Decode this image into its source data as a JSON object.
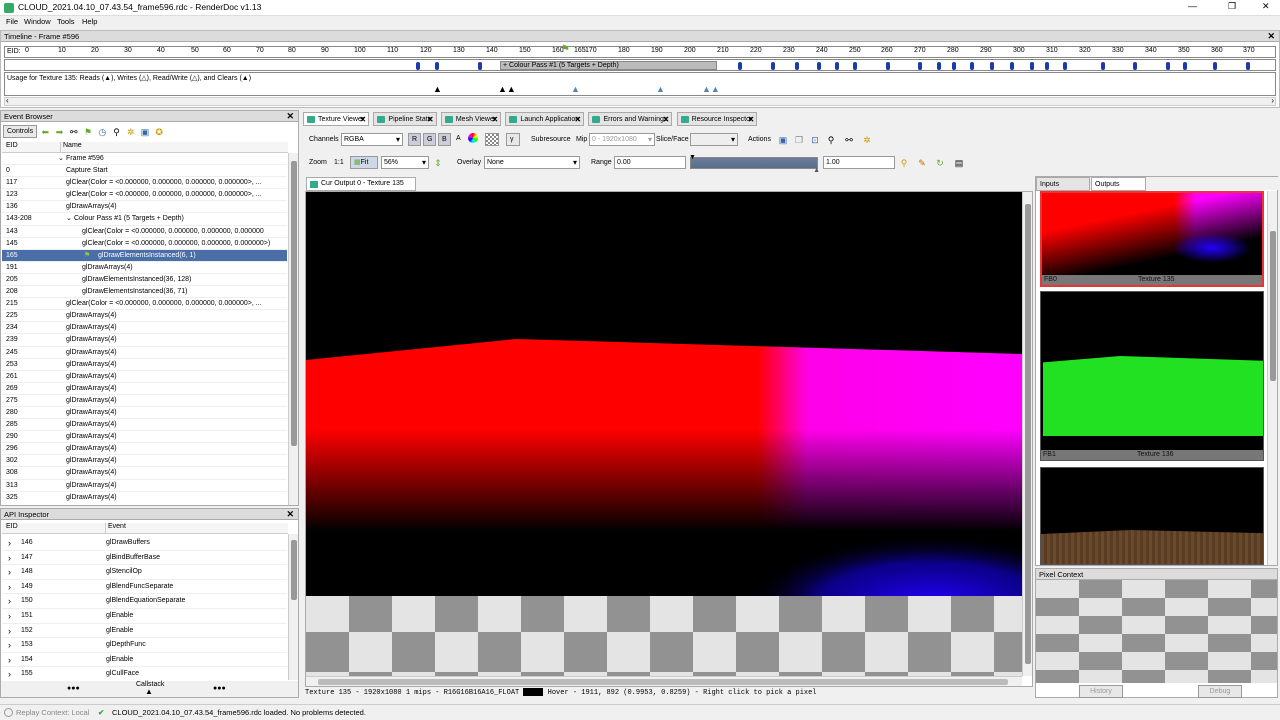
{
  "window": {
    "title": "CLOUD_2021.04.10_07.43.54_frame596.rdc - RenderDoc v1.13",
    "min": "—",
    "max": "❐",
    "close": "✕"
  },
  "menu": [
    "File",
    "Window",
    "Tools",
    "Help"
  ],
  "timeline": {
    "title": "Timeline - Frame #596",
    "eid_label": "EID:",
    "ticks": [
      "0",
      "10",
      "20",
      "30",
      "40",
      "50",
      "60",
      "70",
      "80",
      "90",
      "100",
      "110",
      "120",
      "130",
      "140",
      "150",
      "160",
      "165",
      "170",
      "180",
      "190",
      "200",
      "210",
      "220",
      "230",
      "240",
      "250",
      "260",
      "270",
      "280",
      "290",
      "300",
      "310",
      "320",
      "330",
      "340",
      "350",
      "360",
      "370"
    ],
    "pass_label": "+ Colour Pass #1 (5 Targets + Depth)",
    "usage": "Usage for Texture 135: Reads (▲), Writes (△), Read/Write (△), and Clears (▲)"
  },
  "event_browser": {
    "title": "Event Browser",
    "controls": "Controls",
    "col_eid": "EID",
    "col_name": "Name",
    "rows": [
      {
        "eid": "",
        "name": "Frame #596",
        "indent": 0,
        "tree": "v"
      },
      {
        "eid": "0",
        "name": "Capture Start",
        "indent": 1
      },
      {
        "eid": "117",
        "name": "glClear(Color = <0.000000, 0.000000, 0.000000, 0.000000>, ...",
        "indent": 1
      },
      {
        "eid": "123",
        "name": "glClear(Color = <0.000000, 0.000000, 0.000000, 0.000000>, ...",
        "indent": 1
      },
      {
        "eid": "136",
        "name": "glDrawArrays(4)",
        "indent": 1
      },
      {
        "eid": "143-208",
        "name": "Colour Pass #1 (5 Targets + Depth)",
        "indent": 1,
        "tree": "v"
      },
      {
        "eid": "143",
        "name": "glClear(Color = <0.000000, 0.000000, 0.000000, 0.000000",
        "indent": 2
      },
      {
        "eid": "145",
        "name": "glClear(Color = <0.000000, 0.000000, 0.000000, 0.000000>)",
        "indent": 2
      },
      {
        "eid": "165",
        "name": "glDrawElementsInstanced(6, 1)",
        "indent": 2,
        "selected": true
      },
      {
        "eid": "191",
        "name": "glDrawArrays(4)",
        "indent": 2
      },
      {
        "eid": "205",
        "name": "glDrawElementsInstanced(36, 128)",
        "indent": 2
      },
      {
        "eid": "208",
        "name": "glDrawElementsInstanced(36, 71)",
        "indent": 2
      },
      {
        "eid": "215",
        "name": "glClear(Color = <0.000000, 0.000000, 0.000000, 0.000000>, ...",
        "indent": 1
      },
      {
        "eid": "225",
        "name": "glDrawArrays(4)",
        "indent": 1
      },
      {
        "eid": "234",
        "name": "glDrawArrays(4)",
        "indent": 1
      },
      {
        "eid": "239",
        "name": "glDrawArrays(4)",
        "indent": 1
      },
      {
        "eid": "245",
        "name": "glDrawArrays(4)",
        "indent": 1
      },
      {
        "eid": "253",
        "name": "glDrawArrays(4)",
        "indent": 1
      },
      {
        "eid": "261",
        "name": "glDrawArrays(4)",
        "indent": 1
      },
      {
        "eid": "269",
        "name": "glDrawArrays(4)",
        "indent": 1
      },
      {
        "eid": "275",
        "name": "glDrawArrays(4)",
        "indent": 1
      },
      {
        "eid": "280",
        "name": "glDrawArrays(4)",
        "indent": 1
      },
      {
        "eid": "285",
        "name": "glDrawArrays(4)",
        "indent": 1
      },
      {
        "eid": "290",
        "name": "glDrawArrays(4)",
        "indent": 1
      },
      {
        "eid": "296",
        "name": "glDrawArrays(4)",
        "indent": 1
      },
      {
        "eid": "302",
        "name": "glDrawArrays(4)",
        "indent": 1
      },
      {
        "eid": "308",
        "name": "glDrawArrays(4)",
        "indent": 1
      },
      {
        "eid": "313",
        "name": "glDrawArrays(4)",
        "indent": 1
      },
      {
        "eid": "325",
        "name": "glDrawArrays(4)",
        "indent": 1
      }
    ]
  },
  "api_inspector": {
    "title": "API Inspector",
    "col_eid": "EID",
    "col_event": "Event",
    "rows": [
      {
        "eid": "146",
        "name": "glDrawBuffers"
      },
      {
        "eid": "147",
        "name": "glBindBufferBase"
      },
      {
        "eid": "148",
        "name": "glStencilOp"
      },
      {
        "eid": "149",
        "name": "glBlendFuncSeparate"
      },
      {
        "eid": "150",
        "name": "glBlendEquationSeparate"
      },
      {
        "eid": "151",
        "name": "glEnable"
      },
      {
        "eid": "152",
        "name": "glEnable"
      },
      {
        "eid": "153",
        "name": "glDepthFunc"
      },
      {
        "eid": "154",
        "name": "glEnable"
      },
      {
        "eid": "155",
        "name": "glCullFace"
      }
    ],
    "callstack": "Callstack",
    "dots": "●●●"
  },
  "tabs": [
    "Texture Viewer",
    "Pipeline State",
    "Mesh Viewer",
    "Launch Application",
    "Errors and Warnings",
    "Resource Inspector"
  ],
  "toolbar1": {
    "channels_label": "Channels",
    "channels_value": "RGBA",
    "r": "R",
    "g": "G",
    "b": "B",
    "a": "A",
    "gamma": "γ",
    "subresource": "Subresource",
    "mip_label": "Mip",
    "mip_value": "0 - 1920x1080",
    "slice_label": "Slice/Face",
    "actions": "Actions"
  },
  "toolbar2": {
    "zoom_label": "Zoom",
    "zoom_1to1": "1:1",
    "fit": "Fit",
    "zoom_value": "56%",
    "overlay_label": "Overlay",
    "overlay_value": "None",
    "range_label": "Range",
    "range_min": "0.00",
    "range_max": "1.00"
  },
  "viewer": {
    "subtab": "Cur Output 0 - Texture 135",
    "status_tex": "Texture 135 - 1920x1080 1 mips - R16G16B16A16_FLOAT",
    "status_hover": "Hover - 1911, 892 (0.9953, 0.8259) - Right click to pick a pixel"
  },
  "thumbs": {
    "tab_inputs": "Inputs",
    "tab_outputs": "Outputs",
    "items": [
      {
        "slot": "FB0",
        "name": "Texture 135"
      },
      {
        "slot": "FB1",
        "name": "Texture 136"
      }
    ]
  },
  "pixel_context": {
    "title": "Pixel Context",
    "history": "History",
    "debug": "Debug"
  },
  "statusbar": {
    "replay": "Replay Context: Local",
    "message": "CLOUD_2021.04.10_07.43.54_frame596.rdc loaded. No problems detected."
  },
  "colors": {
    "accent": "#4a6ea8",
    "selected": "#4a6ea8"
  }
}
